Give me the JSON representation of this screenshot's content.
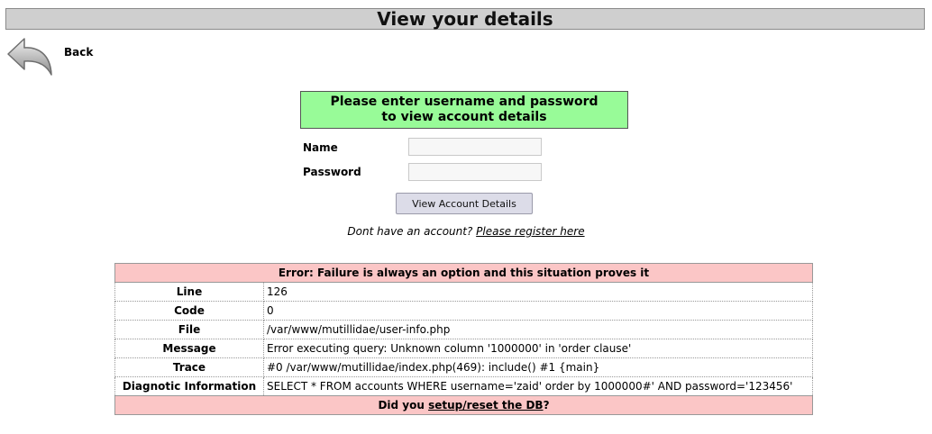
{
  "page": {
    "title": "View your details",
    "back_label": "Back"
  },
  "login": {
    "header_line1": "Please enter username and password",
    "header_line2": "to view account details",
    "name_label": "Name",
    "password_label": "Password",
    "name_value": "",
    "password_value": "",
    "submit_label": "View Account Details",
    "register_prompt": "Dont have an account?",
    "register_link": "Please register here"
  },
  "error": {
    "title": "Error: Failure is always an option and this situation proves it",
    "rows": [
      {
        "label": "Line",
        "value": "126"
      },
      {
        "label": "Code",
        "value": "0"
      },
      {
        "label": "File",
        "value": "/var/www/mutillidae/user-info.php"
      },
      {
        "label": "Message",
        "value": "Error executing query: Unknown column '1000000' in 'order clause'"
      },
      {
        "label": "Trace",
        "value": "#0 /var/www/mutillidae/index.php(469): include() #1 {main}"
      },
      {
        "label": "Diagnotic Information",
        "value": "SELECT * FROM accounts WHERE username='zaid' order by 1000000#' AND password='123456'"
      }
    ],
    "footer_prefix": "Did you",
    "footer_link": "setup/reset the DB",
    "footer_suffix": "?"
  },
  "colors": {
    "title_bar": "#cfcfcf",
    "login_header": "#98fb98",
    "error_bar": "#fbc6c6"
  }
}
